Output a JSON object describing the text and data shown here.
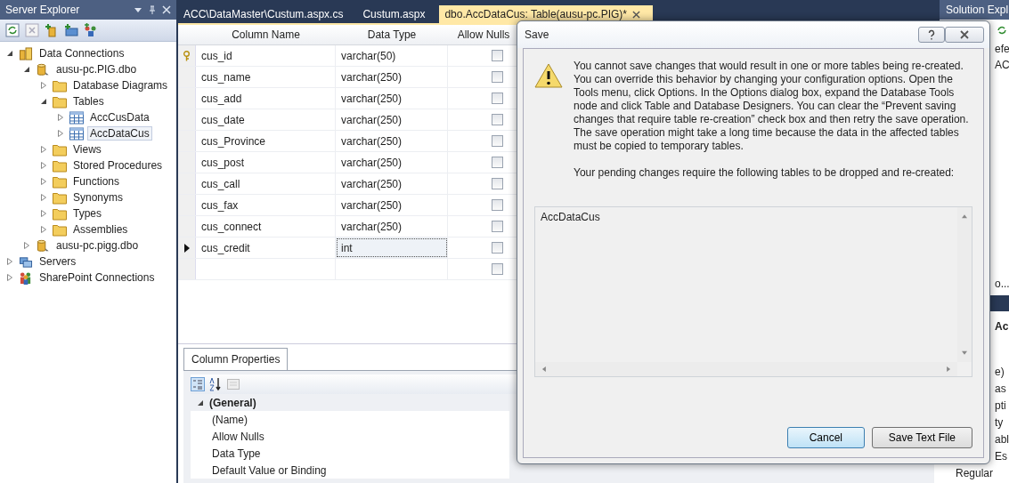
{
  "server_explorer": {
    "title": "Server Explorer",
    "tree": [
      {
        "label": "Data Connections",
        "kind": "connections",
        "expanded": true,
        "selected": false,
        "children": [
          {
            "label": "ausu-pc.PIG.dbo",
            "kind": "database",
            "expanded": true,
            "selected": false,
            "children": [
              {
                "label": "Database Diagrams",
                "kind": "folder",
                "expanded": false,
                "selected": false
              },
              {
                "label": "Tables",
                "kind": "folder",
                "expanded": true,
                "selected": false,
                "children": [
                  {
                    "label": "AccCusData",
                    "kind": "table",
                    "expanded": false,
                    "selected": false
                  },
                  {
                    "label": "AccDataCus",
                    "kind": "table",
                    "expanded": false,
                    "selected": true
                  }
                ]
              },
              {
                "label": "Views",
                "kind": "folder",
                "expanded": false,
                "selected": false
              },
              {
                "label": "Stored Procedures",
                "kind": "folder",
                "expanded": false,
                "selected": false
              },
              {
                "label": "Functions",
                "kind": "folder",
                "expanded": false,
                "selected": false
              },
              {
                "label": "Synonyms",
                "kind": "folder",
                "expanded": false,
                "selected": false
              },
              {
                "label": "Types",
                "kind": "folder",
                "expanded": false,
                "selected": false
              },
              {
                "label": "Assemblies",
                "kind": "folder",
                "expanded": false,
                "selected": false
              }
            ]
          },
          {
            "label": "ausu-pc.pigg.dbo",
            "kind": "database",
            "expanded": false,
            "selected": false
          }
        ]
      },
      {
        "label": "Servers",
        "kind": "servers",
        "expanded": false,
        "selected": false
      },
      {
        "label": "SharePoint Connections",
        "kind": "sharepoint",
        "expanded": false,
        "selected": false
      }
    ]
  },
  "tabs": [
    {
      "label": "ACC\\DataMaster\\Custum.aspx.cs",
      "selected": false
    },
    {
      "label": "Custum.aspx",
      "selected": false
    },
    {
      "label": "dbo.AccDataCus: Table(ausu-pc.PIG)*",
      "selected": true
    }
  ],
  "table_designer": {
    "columns": [
      "Column Name",
      "Data Type",
      "Allow Nulls"
    ],
    "rows": [
      {
        "kind": "column",
        "name": "cus_id",
        "data_type": "varchar(50)",
        "allow_nulls": false,
        "primary_key": true,
        "selected": false
      },
      {
        "kind": "column",
        "name": "cus_name",
        "data_type": "varchar(250)",
        "allow_nulls": false,
        "primary_key": false,
        "selected": false
      },
      {
        "kind": "column",
        "name": "cus_add",
        "data_type": "varchar(250)",
        "allow_nulls": false,
        "primary_key": false,
        "selected": false
      },
      {
        "kind": "column",
        "name": "cus_date",
        "data_type": "varchar(250)",
        "allow_nulls": false,
        "primary_key": false,
        "selected": false
      },
      {
        "kind": "column",
        "name": "cus_Province",
        "data_type": "varchar(250)",
        "allow_nulls": false,
        "primary_key": false,
        "selected": false
      },
      {
        "kind": "column",
        "name": "cus_post",
        "data_type": "varchar(250)",
        "allow_nulls": false,
        "primary_key": false,
        "selected": false
      },
      {
        "kind": "column",
        "name": "cus_call",
        "data_type": "varchar(250)",
        "allow_nulls": false,
        "primary_key": false,
        "selected": false
      },
      {
        "kind": "column",
        "name": "cus_fax",
        "data_type": "varchar(250)",
        "allow_nulls": false,
        "primary_key": false,
        "selected": false
      },
      {
        "kind": "column",
        "name": "cus_connect",
        "data_type": "varchar(250)",
        "allow_nulls": false,
        "primary_key": false,
        "selected": false
      },
      {
        "kind": "column",
        "name": "cus_credit",
        "data_type": "int",
        "allow_nulls": false,
        "primary_key": false,
        "selected": true
      },
      {
        "kind": "new",
        "allow_nulls": false,
        "selected": false
      }
    ]
  },
  "column_properties": {
    "tab": "Column Properties",
    "category": "(General)",
    "expanded": true,
    "rows": [
      {
        "name": "(Name)"
      },
      {
        "name": "Allow Nulls"
      },
      {
        "name": "Data Type"
      },
      {
        "name": "Default Value or Binding"
      }
    ]
  },
  "solution_explorer": {
    "title": "Solution Expl",
    "tree_lines": [
      "efe",
      "AC"
    ],
    "bottom_line": "o...",
    "properties_title": "Ac",
    "property_lines": [
      "e)",
      "as",
      "pti",
      "ty",
      "abl",
      "Es",
      "Regular"
    ]
  },
  "dialog": {
    "title": "Save",
    "message": "You cannot save changes that would result in one or more tables being re-created. You can override this behavior by changing your configuration options. Open the Tools menu, click Options. In the Options dialog box, expand the Database Tools node and click Table and Database Designers. You can clear the “Prevent saving changes that require table re-creation” check box and then retry the save operation. The save operation might take a long time because the data in the affected tables must be copied to temporary tables.",
    "detail": "Your pending changes require the following tables to be dropped and re-created:",
    "tables": [
      "AccDataCus"
    ],
    "buttons": [
      {
        "label": "Cancel",
        "focused": true
      },
      {
        "label": "Save Text File",
        "focused": false
      }
    ]
  }
}
